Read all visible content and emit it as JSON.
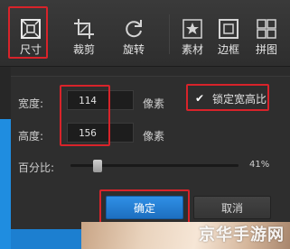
{
  "toolbar": {
    "tools": [
      {
        "id": "size",
        "label": "尺寸",
        "icon": "resize-icon",
        "has_dropdown": true,
        "selected": true
      },
      {
        "id": "crop",
        "label": "裁剪",
        "icon": "crop-icon",
        "has_dropdown": true
      },
      {
        "id": "rotate",
        "label": "旋转",
        "icon": "rotate-icon",
        "has_dropdown": true
      },
      {
        "id": "material",
        "label": "素材",
        "icon": "star-icon",
        "has_dropdown": false
      },
      {
        "id": "border",
        "label": "边框",
        "icon": "frame-icon",
        "has_dropdown": false
      },
      {
        "id": "collage",
        "label": "拼图",
        "icon": "grid-icon",
        "has_dropdown": false
      }
    ]
  },
  "dialog": {
    "width_label": "宽度:",
    "width_value": "114",
    "height_label": "高度:",
    "height_value": "156",
    "unit_label": "像素",
    "lock_ratio_label": "锁定宽高比",
    "lock_ratio_checked": true,
    "percent_label": "百分比:",
    "percent_value": "41%",
    "percent": 41,
    "ok_label": "确定",
    "cancel_label": "取消"
  },
  "watermark": "京华手游网",
  "colors": {
    "highlight": "#d8232a",
    "primary_button": "#2a86dc",
    "toolbar_bg": "#353535",
    "panel_bg": "#2e2e2e"
  }
}
